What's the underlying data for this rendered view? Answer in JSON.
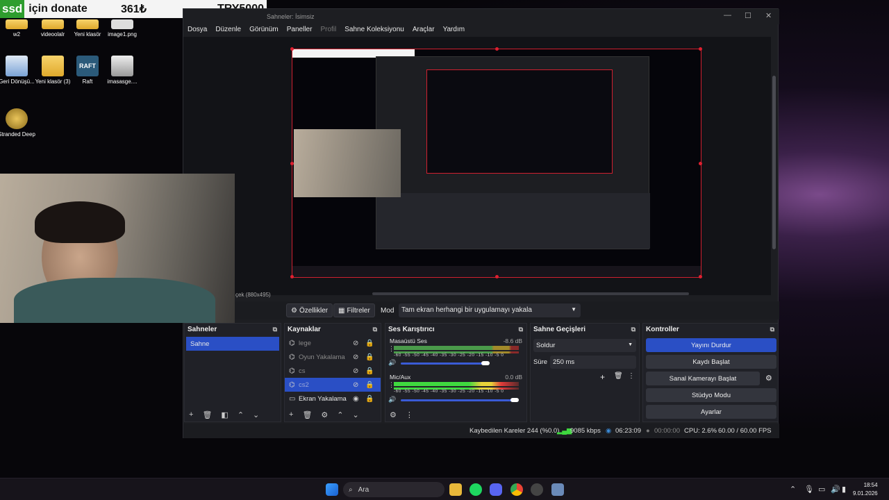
{
  "donate": {
    "ssd": "ssd",
    "text": "için donate",
    "amount": "361₺",
    "goal": "TRY5000"
  },
  "desktop": {
    "icons": [
      {
        "label": "w2",
        "icon": "folder-icon"
      },
      {
        "label": "videoolalr",
        "icon": "folder-icon"
      },
      {
        "label": "Yeni klasör",
        "icon": "folder-icon"
      },
      {
        "label": "image1.png",
        "icon": "image-icon"
      },
      {
        "label": "Geri Dönüşü...",
        "icon": "recycle-bin-icon"
      },
      {
        "label": "Yeni klasör (3)",
        "icon": "folder-icon"
      },
      {
        "label": "Raft",
        "icon": "raft-icon"
      },
      {
        "label": "imasasge....",
        "icon": "image-icon"
      },
      {
        "label": "Stranded Deep",
        "icon": "game-icon"
      }
    ]
  },
  "obs": {
    "title": "Sahneler: İsimsiz",
    "menu": [
      "Dosya",
      "Düzenle",
      "Görünüm",
      "Paneller",
      "Profil",
      "Sahne Koleksiyonu",
      "Araçlar",
      "Yardım"
    ],
    "preview_label": "çek (880x495)",
    "source_toolbar": {
      "properties": "Özellikler",
      "filters": "Filtreler",
      "mode_label": "Mod",
      "mode_value": "Tam ekran herhangi bir uygulamayı yakala"
    },
    "scenes": {
      "title": "Sahneler",
      "items": [
        "Sahne"
      ]
    },
    "sources": {
      "title": "Kaynaklar",
      "items": [
        {
          "label": "lege",
          "visible": false
        },
        {
          "label": "Oyun Yakalama",
          "visible": false
        },
        {
          "label": "cs",
          "visible": false
        },
        {
          "label": "cs2",
          "visible": false,
          "selected": true
        },
        {
          "label": "Ekran Yakalama",
          "visible": true
        }
      ]
    },
    "mixer": {
      "title": "Ses Karıştırıcı",
      "ticks": "-60 -55 -50 -45 -40 -35 -30 -25 -20 -15 -10 -5 0",
      "channels": [
        {
          "name": "Masaüstü Ses",
          "db": "-8.6 dB",
          "level": 0.88
        },
        {
          "name": "Mic/Aux",
          "db": "0.0 dB",
          "level": 1.0
        }
      ]
    },
    "transitions": {
      "title": "Sahne Geçişleri",
      "type": "Soldur",
      "duration_label": "Süre",
      "duration_value": "250 ms"
    },
    "controls": {
      "title": "Kontroller",
      "buttons": [
        "Yayını Durdur",
        "Kaydı Başlat",
        "Sanal Kamerayı Başlat",
        "Stüdyo Modu",
        "Ayarlar"
      ]
    },
    "status": {
      "dropped": "Kaybedilen Kareler 244 (%0.0)",
      "bitrate": "9085 kbps",
      "stream_time": "06:23:09",
      "rec_time": "00:00:00",
      "cpu": "CPU: 2.6%",
      "fps": "60.00 / 60.00 FPS"
    }
  },
  "taskbar": {
    "search": "Ara",
    "time": "18:54",
    "date": "9.01.2026"
  },
  "colors": {
    "accent": "#2a4fc5",
    "selection_red": "#d0202f",
    "meter_green": "#3fd93f"
  }
}
